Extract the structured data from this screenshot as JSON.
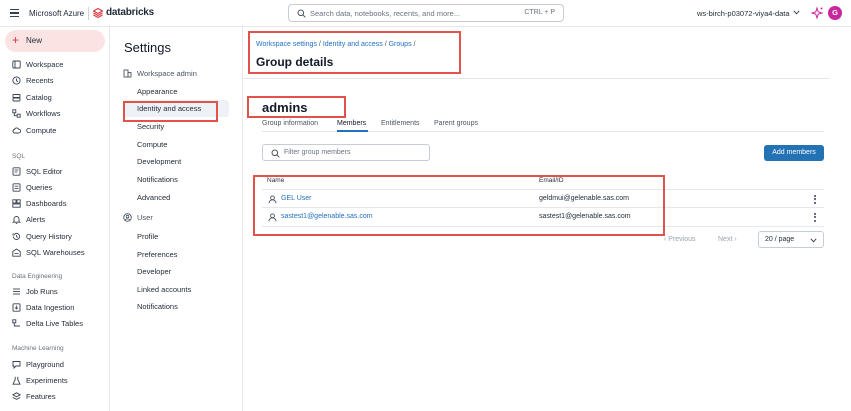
{
  "topbar": {
    "ms_azure": "Microsoft Azure",
    "product": "databricks",
    "search_placeholder": "Search data, notebooks, recents, and more...",
    "search_shortcut": "CTRL + P",
    "workspace": "ws-birch-p03072-viya4-data",
    "avatar_initial": "G",
    "brand_color": "#d9343b"
  },
  "leftnav": {
    "new_label": "New",
    "items": [
      {
        "label": "Workspace",
        "icon": "folder-icon"
      },
      {
        "label": "Recents",
        "icon": "clock-icon"
      },
      {
        "label": "Catalog",
        "icon": "catalog-icon"
      },
      {
        "label": "Workflows",
        "icon": "workflows-icon"
      },
      {
        "label": "Compute",
        "icon": "cloud-icon"
      }
    ],
    "sql_section": "SQL",
    "sql_items": [
      {
        "label": "SQL Editor",
        "icon": "sql-editor-icon"
      },
      {
        "label": "Queries",
        "icon": "queries-icon"
      },
      {
        "label": "Dashboards",
        "icon": "dashboards-icon"
      },
      {
        "label": "Alerts",
        "icon": "bell-icon"
      },
      {
        "label": "Query History",
        "icon": "history-icon"
      },
      {
        "label": "SQL Warehouses",
        "icon": "warehouse-icon"
      }
    ],
    "de_section": "Data Engineering",
    "de_items": [
      {
        "label": "Job Runs",
        "icon": "job-runs-icon"
      },
      {
        "label": "Data Ingestion",
        "icon": "ingestion-icon"
      },
      {
        "label": "Delta Live Tables",
        "icon": "pipeline-icon"
      }
    ],
    "ml_section": "Machine Learning",
    "ml_items": [
      {
        "label": "Playground",
        "icon": "playground-icon"
      },
      {
        "label": "Experiments",
        "icon": "experiments-icon"
      },
      {
        "label": "Features",
        "icon": "features-icon"
      }
    ]
  },
  "settings": {
    "title": "Settings",
    "workspace_admin": "Workspace admin",
    "admin_items": [
      "Appearance",
      "Identity and access",
      "Security",
      "Compute",
      "Development",
      "Notifications",
      "Advanced"
    ],
    "user": "User",
    "user_items": [
      "Profile",
      "Preferences",
      "Developer",
      "Linked accounts",
      "Notifications"
    ]
  },
  "main": {
    "breadcrumb": {
      "root": "Workspace settings",
      "sep": "/",
      "identity": "Identity and access",
      "groups": "Groups"
    },
    "page_title": "Group details",
    "group_name": "admins",
    "tabs": [
      "Group information",
      "Members",
      "Entitlements",
      "Parent groups"
    ],
    "active_tab": "Members",
    "filter_placeholder": "Filter group members",
    "add_members": "Add members",
    "columns": {
      "name": "Name",
      "email": "Email/ID"
    },
    "members": [
      {
        "name": "GEL User",
        "email": "geldmui@gelenable.sas.com"
      },
      {
        "name": "sastest1@gelenable.sas.com",
        "email": "sastest1@gelenable.sas.com"
      }
    ],
    "pager": {
      "prev": "Previous",
      "next": "Next",
      "page_size": "20 / page"
    },
    "highlight_color": "#e0524a",
    "accent_color": "#2272b4"
  }
}
